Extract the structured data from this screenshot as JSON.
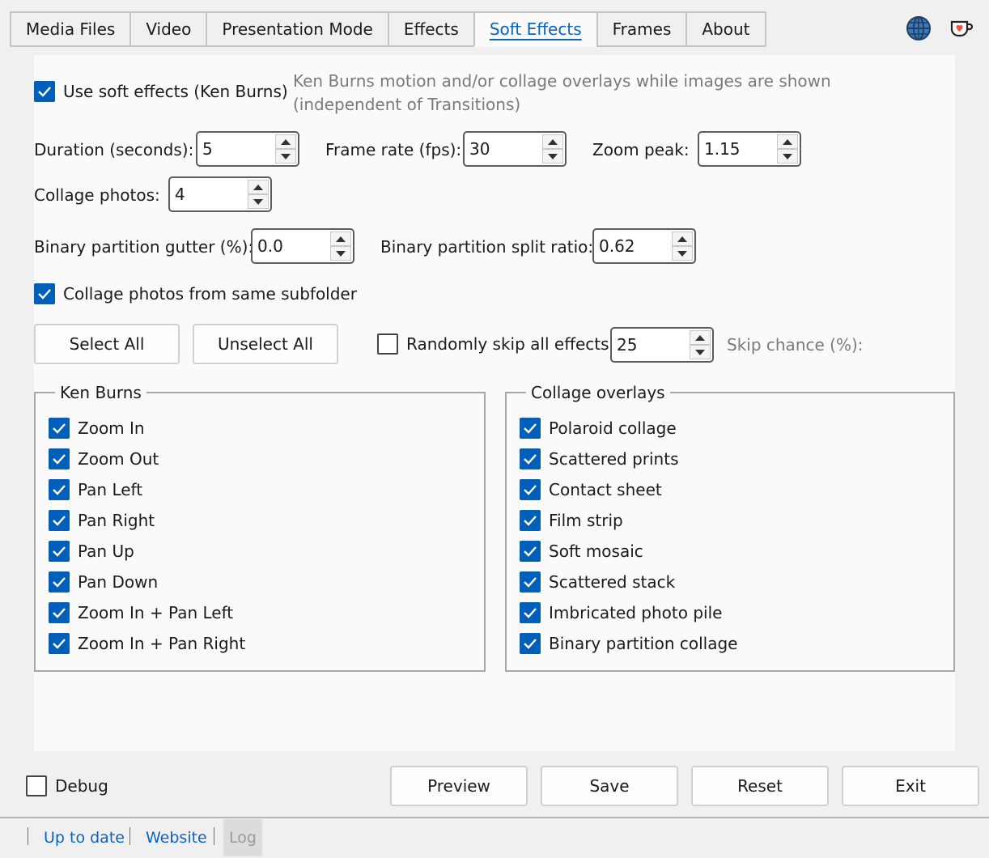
{
  "tabs": [
    {
      "label": "Media Files"
    },
    {
      "label": "Video"
    },
    {
      "label": "Presentation Mode"
    },
    {
      "label": "Effects"
    },
    {
      "label": "Soft Effects",
      "active": true
    },
    {
      "label": "Frames"
    },
    {
      "label": "About"
    }
  ],
  "top_icons": {
    "language": "globe-icon",
    "donate": "coffee-heart-icon"
  },
  "soft_effects": {
    "use_soft": {
      "label": "Use soft effects (Ken Burns)",
      "checked": true
    },
    "description": "Ken Burns motion and/or collage overlays while images are shown (independent of Transitions)",
    "duration": {
      "label": "Duration (seconds):",
      "value": "5"
    },
    "frame_rate": {
      "label": "Frame rate (fps):",
      "value": "30"
    },
    "zoom_peak": {
      "label": "Zoom peak:",
      "value": "1.15"
    },
    "collage_photos": {
      "label": "Collage photos:",
      "value": "4"
    },
    "bp_gutter": {
      "label": "Binary partition gutter (%):",
      "value": "0.0"
    },
    "bp_ratio": {
      "label": "Binary partition split ratio:",
      "value": "0.62"
    },
    "same_subfolder": {
      "label": "Collage photos from same subfolder",
      "checked": true
    },
    "select_all": "Select All",
    "unselect_all": "Unselect All",
    "random_skip": {
      "label": "Randomly skip all effects",
      "checked": false
    },
    "skip_value": "25",
    "skip_chance_label": "Skip chance (%):"
  },
  "ken_burns": {
    "title": "Ken Burns",
    "items": [
      {
        "label": "Zoom In",
        "checked": true
      },
      {
        "label": "Zoom Out",
        "checked": true
      },
      {
        "label": "Pan Left",
        "checked": true
      },
      {
        "label": "Pan Right",
        "checked": true
      },
      {
        "label": "Pan Up",
        "checked": true
      },
      {
        "label": "Pan Down",
        "checked": true
      },
      {
        "label": "Zoom In + Pan Left",
        "checked": true
      },
      {
        "label": "Zoom In + Pan Right",
        "checked": true
      }
    ]
  },
  "collage": {
    "title": "Collage overlays",
    "items": [
      {
        "label": "Polaroid collage",
        "checked": true
      },
      {
        "label": "Scattered prints",
        "checked": true
      },
      {
        "label": "Contact sheet",
        "checked": true
      },
      {
        "label": "Film strip",
        "checked": true
      },
      {
        "label": "Soft mosaic",
        "checked": true
      },
      {
        "label": "Scattered stack",
        "checked": true
      },
      {
        "label": "Imbricated photo pile",
        "checked": true
      },
      {
        "label": "Binary partition collage",
        "checked": true
      }
    ]
  },
  "bottom": {
    "debug": {
      "label": "Debug",
      "checked": false
    },
    "preview": "Preview",
    "save": "Save",
    "reset": "Reset",
    "exit": "Exit"
  },
  "status": {
    "up_to_date": "Up to date",
    "website": "Website",
    "log": "Log"
  },
  "colors": {
    "accent": "#005fb8",
    "link": "#0a62c2"
  }
}
